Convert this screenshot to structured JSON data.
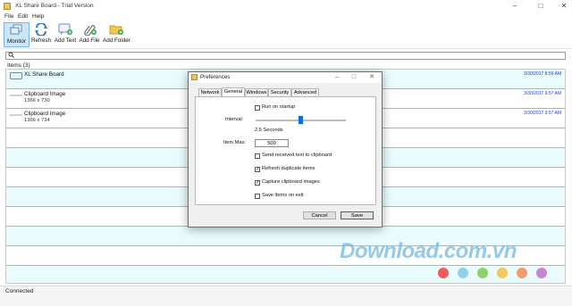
{
  "window": {
    "title": "XL Share Board - Trial Version"
  },
  "menu": [
    "File",
    "Edit",
    "Help"
  ],
  "toolbar": [
    {
      "label": "Monitor",
      "icon": "monitor-icon"
    },
    {
      "label": "Refresh",
      "icon": "refresh-icon"
    },
    {
      "label": "Add Text",
      "icon": "add-text-icon"
    },
    {
      "label": "Add File",
      "icon": "paperclip-icon"
    },
    {
      "label": "Add Folder",
      "icon": "folder-icon"
    }
  ],
  "search": {
    "icon": "search-icon",
    "value": ""
  },
  "items": {
    "header": "Items (3)",
    "list": [
      {
        "title": "XL Share Board",
        "subtitle": "",
        "date": "3/30/2017 8:59 AM",
        "icon": "chat-bubble-icon"
      },
      {
        "title": "Clipboard Image",
        "subtitle": "1366 x 730",
        "date": "3/30/2017 9:57 AM",
        "icon": "image-thumb-icon"
      },
      {
        "title": "Clipboard Image",
        "subtitle": "1366 x 734",
        "date": "3/30/2017 9:57 AM",
        "icon": "image-thumb-icon"
      }
    ]
  },
  "status": "Connected",
  "dialog": {
    "title": "Preferences",
    "tabs": [
      "Network",
      "General",
      "Windows",
      "Security",
      "Advanced"
    ],
    "active_tab": "General",
    "run_on_startup": {
      "label": "Run on startup",
      "checked": false
    },
    "interval": {
      "label": "Interval:",
      "value_text": "2.5 Seconds",
      "slider_fraction": 0.5
    },
    "item_max": {
      "label": "Item Max:",
      "value": "500"
    },
    "options": [
      {
        "label": "Send received text to clipboard",
        "checked": false
      },
      {
        "label": "Refresh duplicate items",
        "checked": true
      },
      {
        "label": "Capture clipboard images",
        "checked": true
      },
      {
        "label": "Save items on exit",
        "checked": false
      }
    ],
    "cancel": "Cancel",
    "save": "Save"
  },
  "watermark": {
    "text": "Download.com.vn",
    "dot_colors": [
      "#ef5b5b",
      "#8fd0ec",
      "#8cd46a",
      "#f5c95b",
      "#f59a6b",
      "#c983d8"
    ]
  }
}
